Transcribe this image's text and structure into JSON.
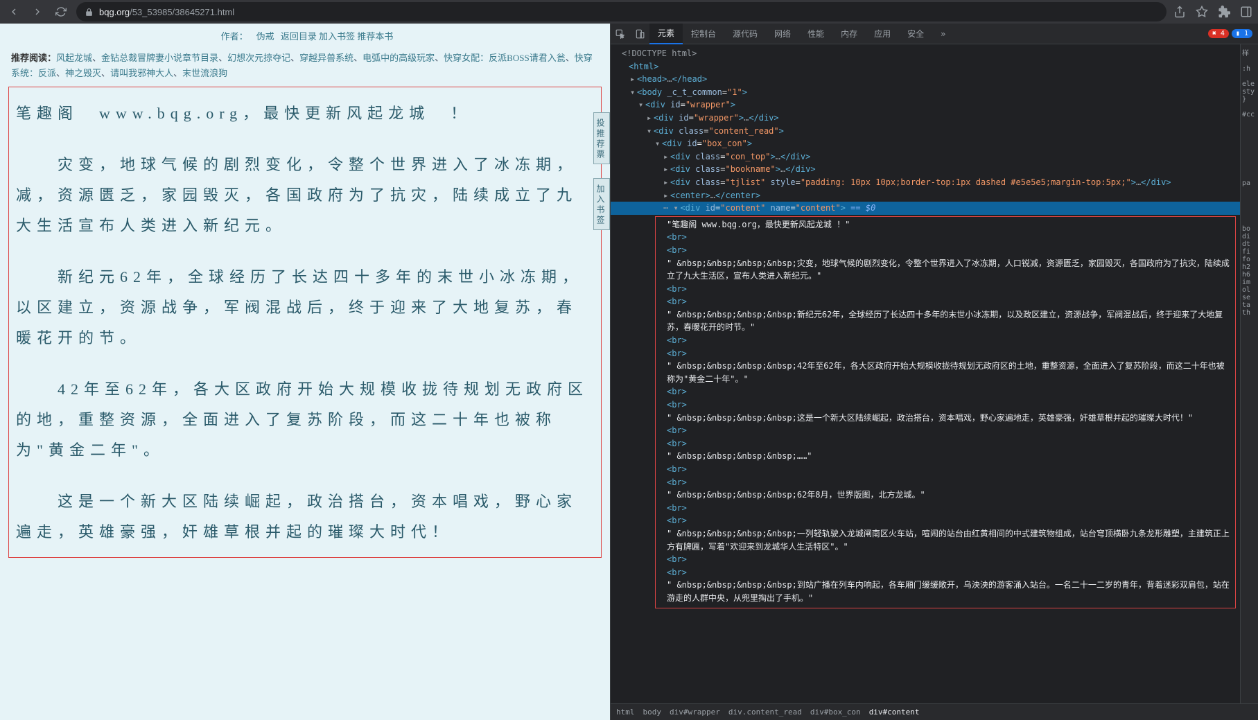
{
  "browser": {
    "url_host": "bqg.org",
    "url_path": "/53_53985/38645271.html"
  },
  "page": {
    "meta": {
      "author_label": "作者：",
      "author": "伪戒",
      "back_index": "返回目录",
      "add_bookmark": "加入书签",
      "recommend_book": "推荐本书"
    },
    "recommend": {
      "label": "推荐阅读：",
      "links": [
        "风起龙城",
        "金钻总裁冒牌妻小说章节目录",
        "幻想次元掠夺记",
        "穿越异兽系统",
        "电弧中的高级玩家",
        "快穿女配：反派BOSS请君入瓮",
        "快穿系统：反派",
        "神之毁灭",
        "请叫我邪神大人",
        "末世流浪狗"
      ]
    },
    "float": {
      "vote": "投 推 荐 票",
      "bookmark": "加 入 书 签"
    },
    "content": [
      "笔趣阁　www.bqg.org，最快更新风起龙城　！",
      "　　灾变，地球气候的剧烈变化，令整个世界进入了冰冻期，减，资源匮乏，家园毁灭，各国政府为了抗灾，陆续成立了九大生活宣布人类进入新纪元。",
      "　　新纪元62年，全球经历了长达四十多年的末世小冰冻期，以区建立，资源战争，军阀混战后，终于迎来了大地复苏，春暖花开的节。",
      "　　42年至62年，各大区政府开始大规模收拢待规划无政府区的地，重整资源，全面进入了复苏阶段，而这二十年也被称为\"黄金二年\"。",
      "　　这是一个新大区陆续崛起，政治搭台，资本唱戏，野心家遍走，英雄豪强，奸雄草根并起的璀璨大时代！"
    ]
  },
  "devtools": {
    "tabs": [
      "元素",
      "控制台",
      "源代码",
      "网络",
      "性能",
      "内存",
      "应用",
      "安全"
    ],
    "errors": "4",
    "infos": "1",
    "doctype": "<!DOCTYPE html>",
    "dom": {
      "html": "<html>",
      "head": "<head>…</head>",
      "body_open": "<body _c_t_common=\"1\">",
      "wrapper1": "<div id=\"wrapper\">",
      "wrapper2": "<div id=\"wrapper\">…</div>",
      "content_read": "<div class=\"content_read\">",
      "box_con": "<div id=\"box_con\">",
      "con_top": "<div class=\"con_top\">…</div>",
      "bookname": "<div class=\"bookname\">…</div>",
      "tjlist": "<div class=\"tjlist\" style=\"padding: 10px 10px;border-top:1px dashed #e5e5e5;margin-top:5px;\">…</div>",
      "center": "<center>…</center>",
      "selected": "<div id=\"content\" name=\"content\"> == $0"
    },
    "text_nodes": [
      "\"笔趣阁 www.bqg.org，最快更新风起龙城 ！\"",
      "<br>",
      "<br>",
      "\" &nbsp;&nbsp;&nbsp;&nbsp;灾变，地球气候的剧烈变化，令整个世界进入了冰冻期，人口锐减，资源匮乏，家园毁灭，各国政府为了抗灾，陆续成立了九大生活区，宣布人类进入新纪元。\"",
      "<br>",
      "<br>",
      "\" &nbsp;&nbsp;&nbsp;&nbsp;新纪元62年，全球经历了长达四十多年的末世小冰冻期，以及政区建立，资源战争，军阀混战后，终于迎来了大地复苏，春暖花开的时节。\"",
      "<br>",
      "<br>",
      "\" &nbsp;&nbsp;&nbsp;&nbsp;42年至62年，各大区政府开始大规模收拢待规划无政府区的土地，重整资源，全面进入了复苏阶段，而这二十年也被称为\"黄金二十年\"。\"",
      "<br>",
      "<br>",
      "\" &nbsp;&nbsp;&nbsp;&nbsp;这是一个新大区陆续崛起，政治搭台，资本唱戏，野心家遍地走，英雄豪强，奸雄草根并起的璀璨大时代！\"",
      "<br>",
      "<br>",
      "\" &nbsp;&nbsp;&nbsp;&nbsp;……\"",
      "<br>",
      "<br>",
      "\" &nbsp;&nbsp;&nbsp;&nbsp;62年8月，世界版图，北方龙城。\"",
      "<br>",
      "<br>",
      "\" &nbsp;&nbsp;&nbsp;&nbsp;一列轻轨驶入龙城闸南区火车站，喧闹的站台由红黄相间的中式建筑物组成，站台穹顶横卧九条龙形雕塑，主建筑正上方有牌匾，写着\"欢迎来到龙城华人生活特区\"。\"",
      "<br>",
      "<br>",
      "\" &nbsp;&nbsp;&nbsp;&nbsp;到站广播在列车内响起，各车厢门缓缓敞开，乌泱泱的游客涌入站台。一名二十一二岁的青年，背着迷彩双肩包，站在游走的人群中央，从兜里掏出了手机。\""
    ],
    "breadcrumb": [
      "html",
      "body",
      "div#wrapper",
      "div.content_read",
      "div#box_con",
      "div#content"
    ]
  },
  "sidebar_hints": {
    "top": "样",
    "h": ":h",
    "ele": "ele",
    "sty": "sty",
    "cc": "#cc",
    "pa": "pa",
    "bo": "bo",
    "di": "di",
    "dt": "dt",
    "fi": "fi",
    "fo": "fo",
    "h2": "h2",
    "h6": "h6",
    "im": "im",
    "ol": "ol",
    "se": "se",
    "ta": "ta",
    "th": "th"
  }
}
